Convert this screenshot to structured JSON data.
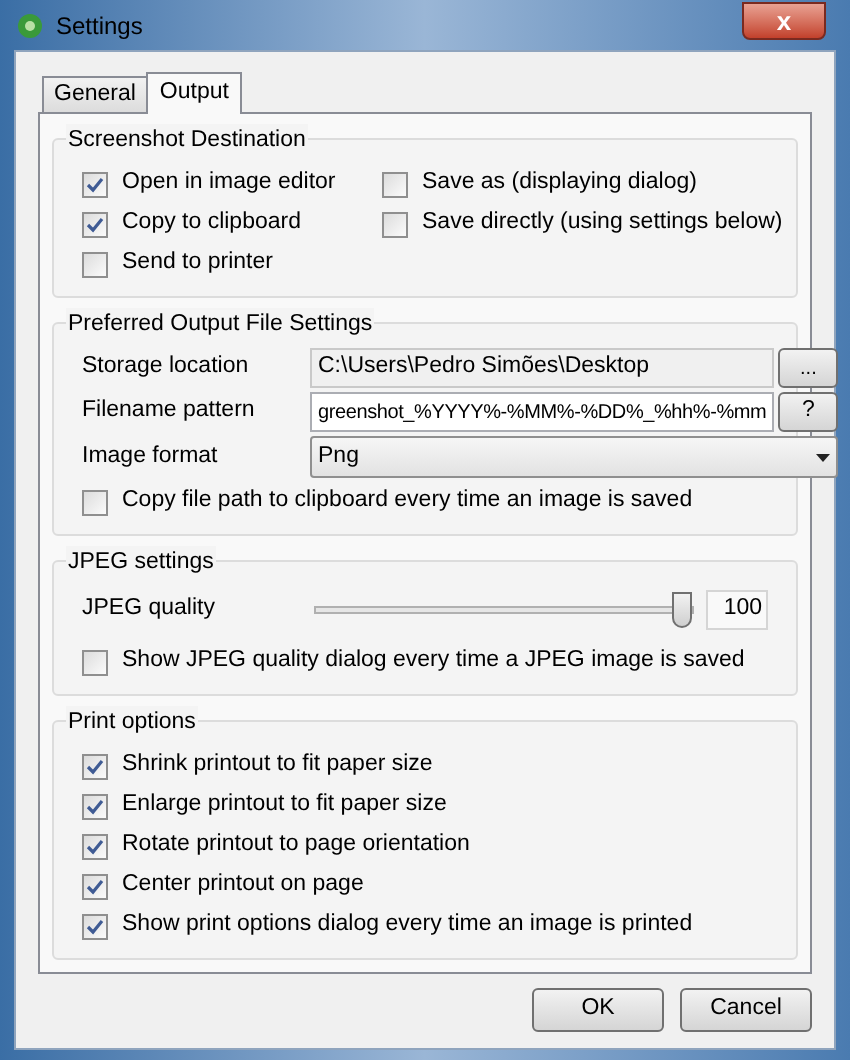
{
  "window": {
    "title": "Settings",
    "close": "x"
  },
  "tabs": [
    {
      "label": "General",
      "selected": false
    },
    {
      "label": "Output",
      "selected": true
    }
  ],
  "destination": {
    "title": "Screenshot Destination",
    "options": [
      {
        "label": "Open in image editor",
        "checked": true
      },
      {
        "label": "Copy to clipboard",
        "checked": true
      },
      {
        "label": "Send to printer",
        "checked": false
      },
      {
        "label": "Save as (displaying dialog)",
        "checked": false
      },
      {
        "label": "Save directly (using settings below)",
        "checked": false
      }
    ]
  },
  "output_file": {
    "title": "Preferred Output File Settings",
    "storage_label": "Storage location",
    "storage_value": "C:\\Users\\Pedro Simões\\Desktop",
    "browse_button": "...",
    "pattern_label": "Filename pattern",
    "pattern_value": "greenshot_%YYYY%-%MM%-%DD%_%hh%-%mm",
    "help_button": "?",
    "format_label": "Image format",
    "format_value": "Png",
    "copy_path": {
      "label": "Copy file path to clipboard every time an image is saved",
      "checked": false
    }
  },
  "jpeg": {
    "title": "JPEG settings",
    "quality_label": "JPEG quality",
    "level": 1,
    "quality_value": "100",
    "show_dialog": {
      "label": "Show JPEG quality dialog every time a JPEG image is saved",
      "checked": false
    }
  },
  "print": {
    "title": "Print options",
    "options": [
      {
        "label": "Shrink printout to fit paper size",
        "checked": true
      },
      {
        "label": "Enlarge printout to fit paper size",
        "checked": true
      },
      {
        "label": "Rotate printout to page orientation",
        "checked": true
      },
      {
        "label": "Center printout on page",
        "checked": true
      },
      {
        "label": "Show print options dialog every time an image is printed",
        "checked": true
      }
    ]
  },
  "buttons": [
    "OK",
    "Cancel"
  ]
}
